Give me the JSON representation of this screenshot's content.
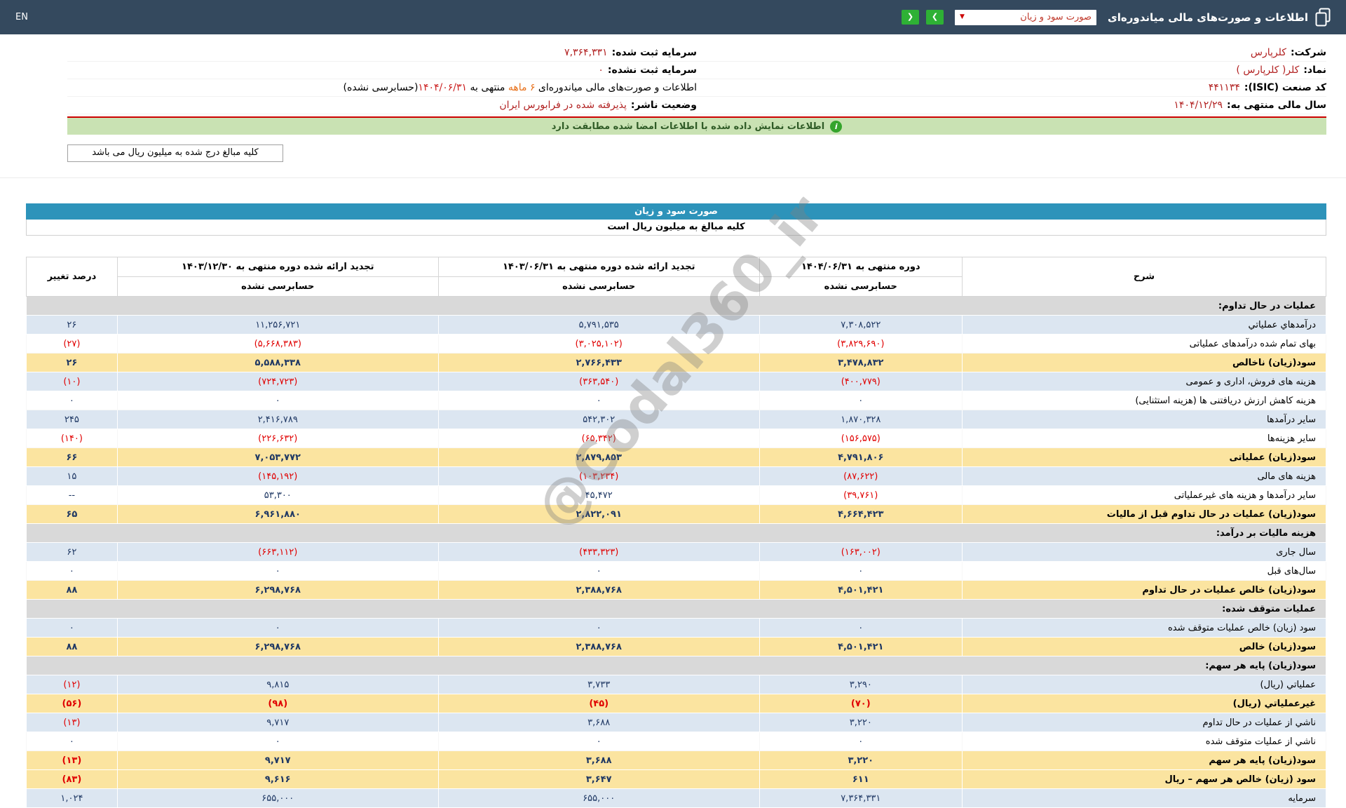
{
  "topbar": {
    "en_label": "EN",
    "title": "اطلاعات و صورت‌های مالی میاندوره‌ای",
    "statement_dropdown_value": "صورت سود و زیان",
    "caret_icon": "▼",
    "nav_forward_icon": "❯",
    "nav_back_icon": "❮"
  },
  "company": {
    "rows": [
      {
        "right_label": "شرکت:",
        "right_value": "کلرپارس",
        "left_label": "سرمایه ثبت شده:",
        "left_value": "۷,۳۶۴,۳۳۱"
      },
      {
        "right_label": "نماد:",
        "right_value": "کلر( کلرپارس )",
        "left_label": "سرمایه ثبت نشده:",
        "left_value": "۰"
      },
      {
        "right_label": "کد صنعت (ISIC):",
        "right_value": "۴۴۱۱۳۴",
        "left_segments": [
          {
            "text": "اطلاعات و صورت‌های مالی میاندوره‌ای ",
            "color": "black"
          },
          {
            "text": "۶ ماهه",
            "color": "orange"
          },
          {
            "text": " منتهی به ",
            "color": "black"
          },
          {
            "text": "۱۴۰۴/۰۶/۳۱",
            "color": "red"
          },
          {
            "text": "(حسابرسی نشده)",
            "color": "black"
          }
        ]
      },
      {
        "right_label": "سال مالی منتهی به:",
        "right_value": "۱۴۰۴/۱۲/۲۹",
        "left_label": "وضعیت ناشر:",
        "left_value": "پذیرفته شده در فرابورس ایران"
      }
    ]
  },
  "banner": {
    "info_icon": "i",
    "text": "اطلاعات نمایش داده شده با اطلاعات امضا شده مطابقت دارد"
  },
  "note_tab": "کلیه مبالغ درج شده به میلیون ریال می باشد",
  "statement": {
    "title": "صورت سود و زیان",
    "subtitle": "کلیه مبالغ به میلیون ریال است"
  },
  "table": {
    "header": {
      "desc": "شرح",
      "periods": [
        {
          "title": "دوره منتهی به ۱۴۰۴/۰۶/۳۱",
          "sub": "حسابرسی نشده"
        },
        {
          "title": "تجدید ارائه شده دوره منتهی به ۱۴۰۳/۰۶/۳۱",
          "sub": "حسابرسی نشده"
        },
        {
          "title": "تجدید ارائه شده دوره منتهی به ۱۴۰۳/۱۲/۳۰",
          "sub": "حسابرسی نشده"
        }
      ],
      "change": "درصد تغییر"
    },
    "rows": [
      {
        "type": "section",
        "desc": "عملیات در حال تداوم:"
      },
      {
        "type": "data",
        "bg": "blue",
        "desc": "درآمدهاي عملياتي",
        "values": [
          "۷,۳۰۸,۵۲۲",
          "۵,۷۹۱,۵۳۵",
          "۱۱,۲۵۶,۷۲۱"
        ],
        "change": "۲۶"
      },
      {
        "type": "data",
        "bg": "white",
        "desc": "بهای تمام شده درآمدهای عملیاتی",
        "values": [
          "(۳,۸۲۹,۶۹۰)",
          "(۳,۰۲۵,۱۰۲)",
          "(۵,۶۶۸,۳۸۳)"
        ],
        "change": "(۲۷)"
      },
      {
        "type": "data",
        "bg": "yellow",
        "desc": "سود(زیان) ناخالص",
        "values": [
          "۳,۴۷۸,۸۳۲",
          "۲,۷۶۶,۴۳۳",
          "۵,۵۸۸,۳۳۸"
        ],
        "change": "۲۶"
      },
      {
        "type": "data",
        "bg": "blue",
        "desc": "هزینه های فروش، اداری و عمومی",
        "values": [
          "(۴۰۰,۷۷۹)",
          "(۳۶۳,۵۴۰)",
          "(۷۲۴,۷۲۳)"
        ],
        "change": "(۱۰)"
      },
      {
        "type": "data",
        "bg": "white",
        "desc": "هزینه کاهش ارزش دریافتنی ها (هزینه استثنایی)",
        "values": [
          "۰",
          "۰",
          "۰"
        ],
        "change": "۰"
      },
      {
        "type": "data",
        "bg": "blue",
        "desc": "سایر درآمدها",
        "values": [
          "۱,۸۷۰,۳۲۸",
          "۵۴۲,۳۰۲",
          "۲,۴۱۶,۷۸۹"
        ],
        "change": "۲۴۵"
      },
      {
        "type": "data",
        "bg": "white",
        "desc": "سایر هزینه‌ها",
        "values": [
          "(۱۵۶,۵۷۵)",
          "(۶۵,۳۴۲)",
          "(۲۲۶,۶۳۲)"
        ],
        "change": "(۱۴۰)"
      },
      {
        "type": "data",
        "bg": "yellow",
        "desc": "سود(زیان) عملیاتی",
        "values": [
          "۴,۷۹۱,۸۰۶",
          "۲,۸۷۹,۸۵۳",
          "۷,۰۵۳,۷۷۲"
        ],
        "change": "۶۶"
      },
      {
        "type": "data",
        "bg": "blue",
        "desc": "هزینه های مالی",
        "values": [
          "(۸۷,۶۲۲)",
          "(۱۰۳,۲۳۴)",
          "(۱۴۵,۱۹۲)"
        ],
        "change": "۱۵"
      },
      {
        "type": "data",
        "bg": "white",
        "desc": "سایر درآمدها و هزینه های غیرعملیاتی",
        "values": [
          "(۳۹,۷۶۱)",
          "۴۵,۴۷۲",
          "۵۳,۳۰۰"
        ],
        "change": "--"
      },
      {
        "type": "data",
        "bg": "yellow",
        "desc": "سود(زیان) عملیات در حال تداوم قبل از مالیات",
        "values": [
          "۴,۶۶۴,۴۲۳",
          "۲,۸۲۲,۰۹۱",
          "۶,۹۶۱,۸۸۰"
        ],
        "change": "۶۵"
      },
      {
        "type": "section",
        "desc": "هزینه مالیات بر درآمد:"
      },
      {
        "type": "data",
        "bg": "blue",
        "desc": "سال جاری",
        "values": [
          "(۱۶۳,۰۰۲)",
          "(۴۳۳,۳۲۳)",
          "(۶۶۳,۱۱۲)"
        ],
        "change": "۶۲"
      },
      {
        "type": "data",
        "bg": "white",
        "desc": "سال‌های قبل",
        "values": [
          "۰",
          "۰",
          "۰"
        ],
        "change": "۰"
      },
      {
        "type": "data",
        "bg": "yellow",
        "desc": "سود(زیان) خالص عملیات در حال تداوم",
        "values": [
          "۴,۵۰۱,۴۲۱",
          "۲,۳۸۸,۷۶۸",
          "۶,۲۹۸,۷۶۸"
        ],
        "change": "۸۸"
      },
      {
        "type": "section",
        "desc": "عملیات متوقف شده:"
      },
      {
        "type": "data",
        "bg": "blue",
        "desc": "سود (زیان) خالص عملیات متوقف شده",
        "values": [
          "۰",
          "۰",
          "۰"
        ],
        "change": "۰"
      },
      {
        "type": "data",
        "bg": "yellow",
        "desc": "سود(زیان) خالص",
        "values": [
          "۴,۵۰۱,۴۲۱",
          "۲,۳۸۸,۷۶۸",
          "۶,۲۹۸,۷۶۸"
        ],
        "change": "۸۸"
      },
      {
        "type": "section",
        "desc": "سود(زیان) پایه هر سهم:"
      },
      {
        "type": "data",
        "bg": "blue",
        "desc": "عملياتي (ريال)",
        "values": [
          "۳,۲۹۰",
          "۳,۷۳۳",
          "۹,۸۱۵"
        ],
        "change": "(۱۲)"
      },
      {
        "type": "data",
        "bg": "yellow",
        "desc": "غیرعملیاتي (ریال)",
        "values": [
          "(۷۰)",
          "(۴۵)",
          "(۹۸)"
        ],
        "change": "(۵۶)"
      },
      {
        "type": "data",
        "bg": "blue",
        "desc": "ناشي از عملیات در حال تداوم",
        "values": [
          "۳,۲۲۰",
          "۳,۶۸۸",
          "۹,۷۱۷"
        ],
        "change": "(۱۳)"
      },
      {
        "type": "data",
        "bg": "white",
        "desc": "ناشي از عملیات متوقف شده",
        "values": [
          "۰",
          "۰",
          "۰"
        ],
        "change": "۰"
      },
      {
        "type": "data",
        "bg": "yellow",
        "desc": "سود(زیان) پایه هر سهم",
        "values": [
          "۳,۲۲۰",
          "۳,۶۸۸",
          "۹,۷۱۷"
        ],
        "change": "(۱۳)"
      },
      {
        "type": "data",
        "bg": "yellow",
        "desc": "سود (زیان) خالص هر سهم – ریال",
        "values": [
          "۶۱۱",
          "۳,۶۴۷",
          "۹,۶۱۶"
        ],
        "change": "(۸۳)"
      },
      {
        "type": "data",
        "bg": "blue",
        "desc": "سرمایه",
        "values": [
          "۷,۳۶۴,۳۳۱",
          "۶۵۵,۰۰۰",
          "۶۵۵,۰۰۰"
        ],
        "change": "۱,۰۲۴"
      }
    ]
  },
  "watermark": "@Codal360_ir"
}
